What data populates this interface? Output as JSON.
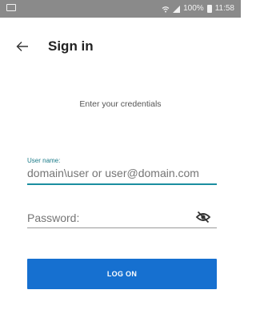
{
  "status_bar": {
    "battery_percent": "100%",
    "time": "11:58",
    "icons": [
      "notification-icon",
      "wifi-icon",
      "signal-icon",
      "battery-icon"
    ]
  },
  "header": {
    "title": "Sign in",
    "back_icon": "arrow-left-icon"
  },
  "form": {
    "instruction": "Enter your credentials",
    "username_label": "User name:",
    "username_placeholder": "domain\\user or user@domain.com",
    "password_placeholder": "Password:",
    "password_toggle_icon": "eye-off-icon",
    "submit_label": "LOG ON"
  },
  "colors": {
    "accent": "#1b8ea0",
    "button": "#1670d0",
    "status_bar": "#8a8a8a"
  }
}
